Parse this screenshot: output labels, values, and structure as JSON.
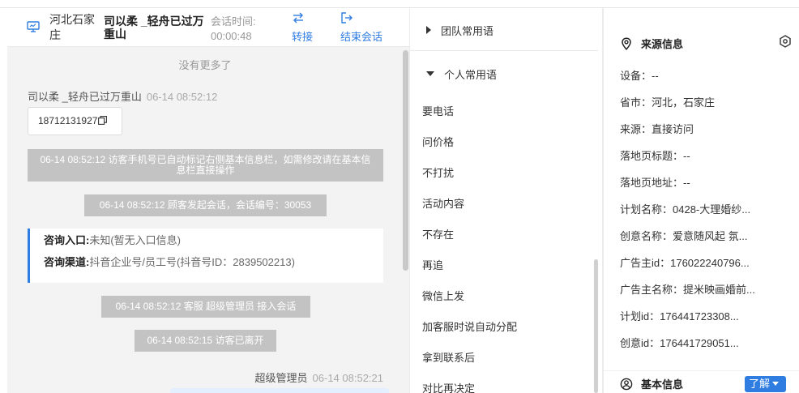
{
  "top_strip": {
    "fragment": ""
  },
  "chat": {
    "customer_location": "河北石家庄",
    "customer_name": "司以柔 _轻舟已过万重山",
    "timer_label": "会话时间:",
    "timer_value": "00:00:48",
    "transfer_label": "转接",
    "end_label": "结束会话",
    "no_more": "没有更多了",
    "visitor_msg": {
      "sender": "司以柔 _轻舟已过万重山",
      "time": "06-14 08:52:12",
      "text": "18712131927"
    },
    "system_1": "06-14 08:52:12 访客手机号已自动标记右侧基本信息栏，如需修改请在基本信息栏直接操作",
    "system_2": "06-14 08:52:12 顾客发起会话，会话编号：30053",
    "consult_entry_key": "咨询入口:",
    "consult_entry_val": "未知(暂无入口信息)",
    "consult_channel_key": "咨询渠道:",
    "consult_channel_val": "抖音企业号/员工号(抖音号ID：2839502213)",
    "system_3": "06-14 08:52:12 客服 超级管理员 接入会话",
    "system_4": "06-14 08:52:15 访客已离开",
    "agent_name": "超级管理员",
    "agent_time": "06-14 08:52:21"
  },
  "phrases": {
    "team_group": "团队常用语",
    "personal_group": "个人常用语",
    "items": [
      "要电话",
      "问价格",
      "不打扰",
      "活动内容",
      "不存在",
      "再追",
      "微信上发",
      "加客服时说自动分配",
      "拿到联系后",
      "对比再决定"
    ]
  },
  "source_info": {
    "title": "来源信息",
    "device": "设备：--",
    "province": "省市：河北，石家庄",
    "source": "来源：直接访问",
    "landing_title": "落地页标题：--",
    "landing_url": "落地页地址：--",
    "plan_name": "计划名称：0428-大理婚纱...",
    "creative_name": "创意名称：爱意随风起 氛...",
    "advertiser_id": "广告主id：176022240796...",
    "advertiser_name": "广告主名称：提米映画婚前...",
    "plan_id": "计划id：176441723308...",
    "creative_id": "创意id：176441729051..."
  },
  "basic_info": {
    "title": "基本信息",
    "learn_label": "了解"
  },
  "colors": {
    "accent": "#2f7de1",
    "system_bg": "#c3c3c3",
    "chat_bg": "#f3f3f3"
  }
}
